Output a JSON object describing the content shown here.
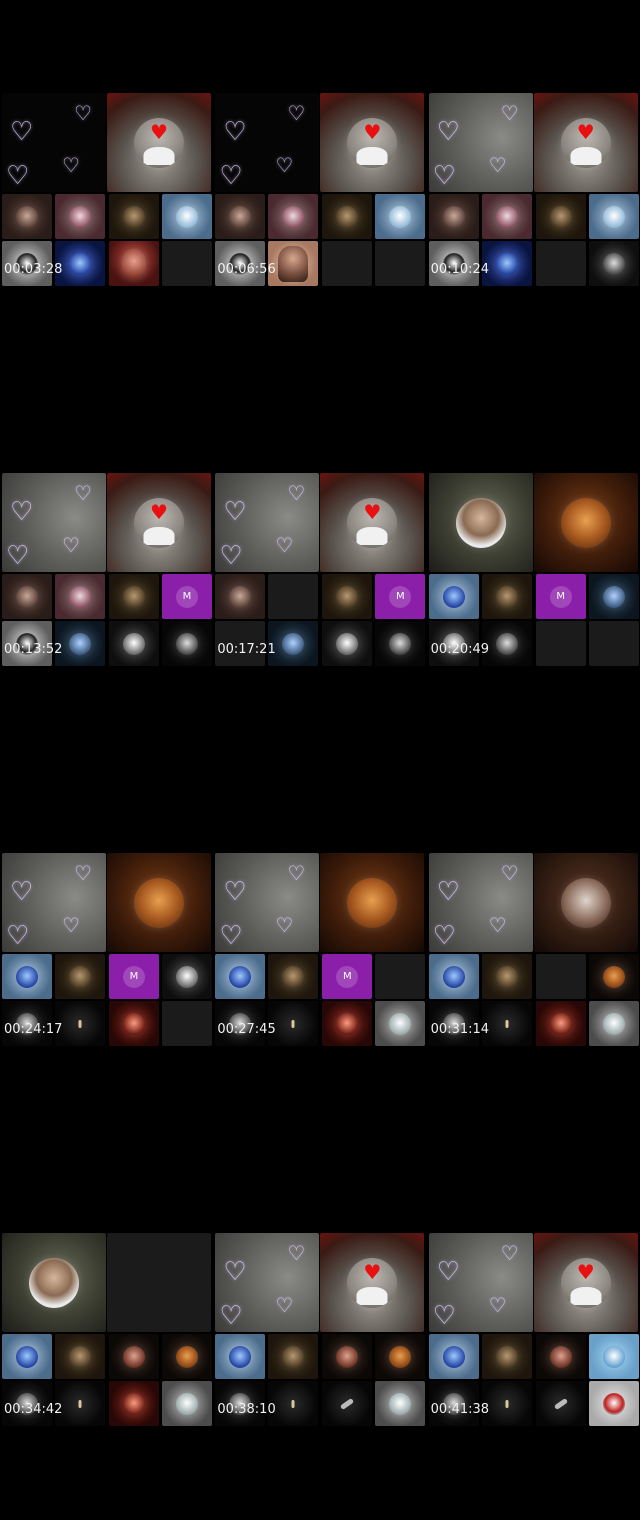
{
  "contact_sheet": {
    "timestamps": [
      "00:03:28",
      "00:06:56",
      "00:10:24",
      "00:13:52",
      "00:17:21",
      "00:20:49",
      "00:24:17",
      "00:27:45",
      "00:31:14",
      "00:34:42",
      "00:38:10",
      "00:41:38"
    ],
    "participant_initial": "M",
    "background_color": "#000000",
    "participant_tile_color": "#8b1faa",
    "heart_icon_color": "#e81010"
  }
}
